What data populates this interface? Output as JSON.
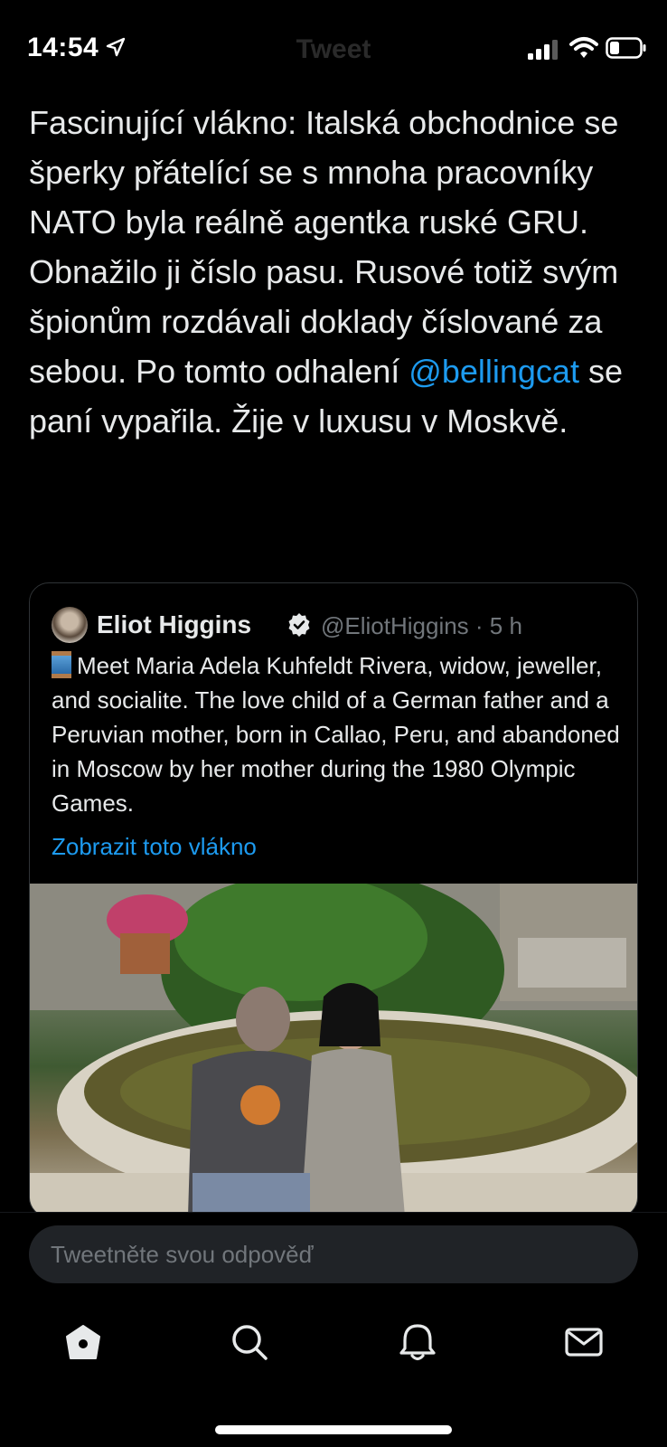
{
  "status_bar": {
    "time": "14:54"
  },
  "nav": {
    "title": "Tweet"
  },
  "tweet": {
    "text_before": "Fascinující vlákno: Italská obchodnice se šperky přátelící se s mnoha pracovníky NATO byla reálně agentka ruské GRU. Obnažilo ji číslo pasu. Rusové totiž svým špionům rozdávali doklady číslované za sebou. Po tomto odhalení ",
    "mention": "@bellingcat",
    "text_after": " se paní vypařila. Žije v luxusu v Moskvě."
  },
  "quoted_tweet": {
    "author_name": "Eliot Higgins",
    "handle_time": "@EliotHiggins · 5 h",
    "body": "Meet Maria Adela Kuhfeldt Rivera, widow, jeweller, and socialite. The love child of a German father and a Peruvian mother, born in Callao, Peru, and abandoned in Moscow by her mother during the 1980 Olympic Games.",
    "show_thread": "Zobrazit toto vlákno"
  },
  "reply": {
    "placeholder": "Tweetněte svou odpověď"
  },
  "tabs": [
    "home-icon",
    "search-icon",
    "notifications-icon",
    "messages-icon"
  ]
}
